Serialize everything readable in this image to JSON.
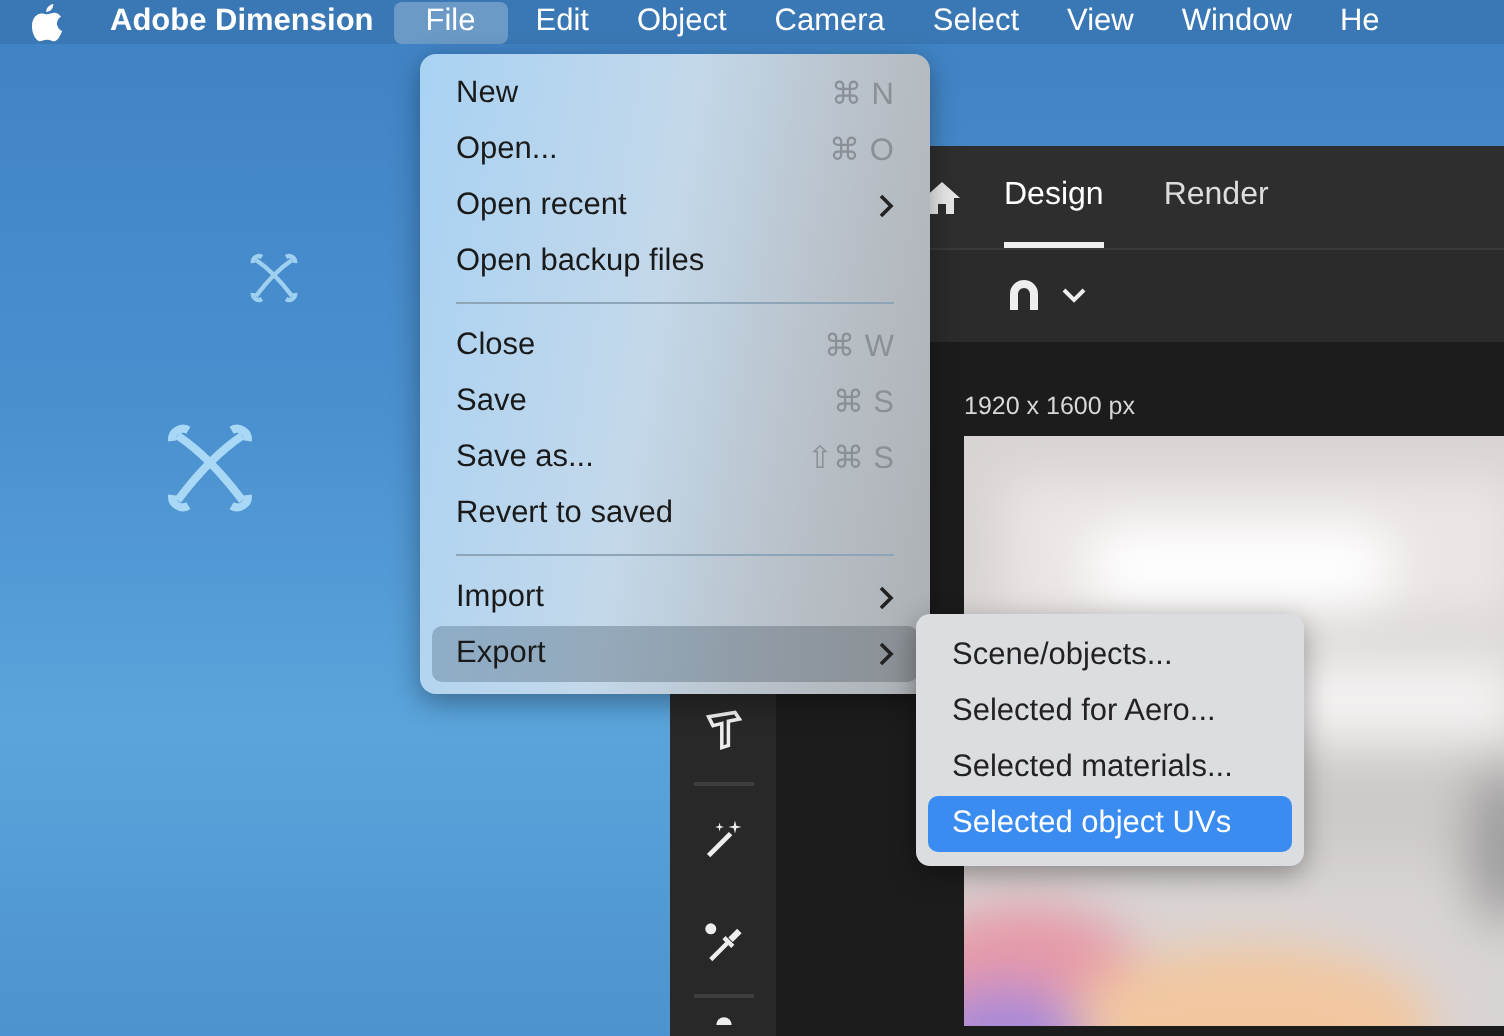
{
  "menu_bar": {
    "app_name": "Adobe Dimension",
    "menus": [
      {
        "label": "File",
        "selected": true
      },
      {
        "label": "Edit",
        "selected": false
      },
      {
        "label": "Object",
        "selected": false
      },
      {
        "label": "Camera",
        "selected": false
      },
      {
        "label": "Select",
        "selected": false
      },
      {
        "label": "View",
        "selected": false
      },
      {
        "label": "Window",
        "selected": false
      },
      {
        "label": "He",
        "selected": false
      }
    ]
  },
  "app_window": {
    "tabs": [
      {
        "label": "Design",
        "selected": true
      },
      {
        "label": "Render",
        "selected": false
      }
    ],
    "canvas_size": "1920 x 1600 px"
  },
  "file_menu": {
    "items": [
      {
        "kind": "item",
        "label": "New",
        "shortcut": "⌘ N",
        "submenu": false,
        "selected": false
      },
      {
        "kind": "item",
        "label": "Open...",
        "shortcut": "⌘ O",
        "submenu": false,
        "selected": false
      },
      {
        "kind": "item",
        "label": "Open recent",
        "submenu": true,
        "selected": false
      },
      {
        "kind": "item",
        "label": "Open backup files",
        "submenu": false,
        "selected": false
      },
      {
        "kind": "separator"
      },
      {
        "kind": "item",
        "label": "Close",
        "shortcut": "⌘ W",
        "submenu": false,
        "selected": false
      },
      {
        "kind": "item",
        "label": "Save",
        "shortcut": "⌘ S",
        "submenu": false,
        "selected": false
      },
      {
        "kind": "item",
        "label": "Save as...",
        "shortcut": "⇧⌘ S",
        "submenu": false,
        "selected": false
      },
      {
        "kind": "item",
        "label": "Revert to saved",
        "submenu": false,
        "selected": false
      },
      {
        "kind": "separator"
      },
      {
        "kind": "item",
        "label": "Import",
        "submenu": true,
        "selected": false
      },
      {
        "kind": "item",
        "label": "Export",
        "submenu": true,
        "selected": true
      }
    ]
  },
  "export_submenu": {
    "items": [
      {
        "label": "Scene/objects...",
        "selected": false
      },
      {
        "label": "Selected for Aero...",
        "selected": false
      },
      {
        "label": "Selected materials...",
        "selected": false
      },
      {
        "label": "Selected object UVs",
        "selected": true
      }
    ]
  }
}
